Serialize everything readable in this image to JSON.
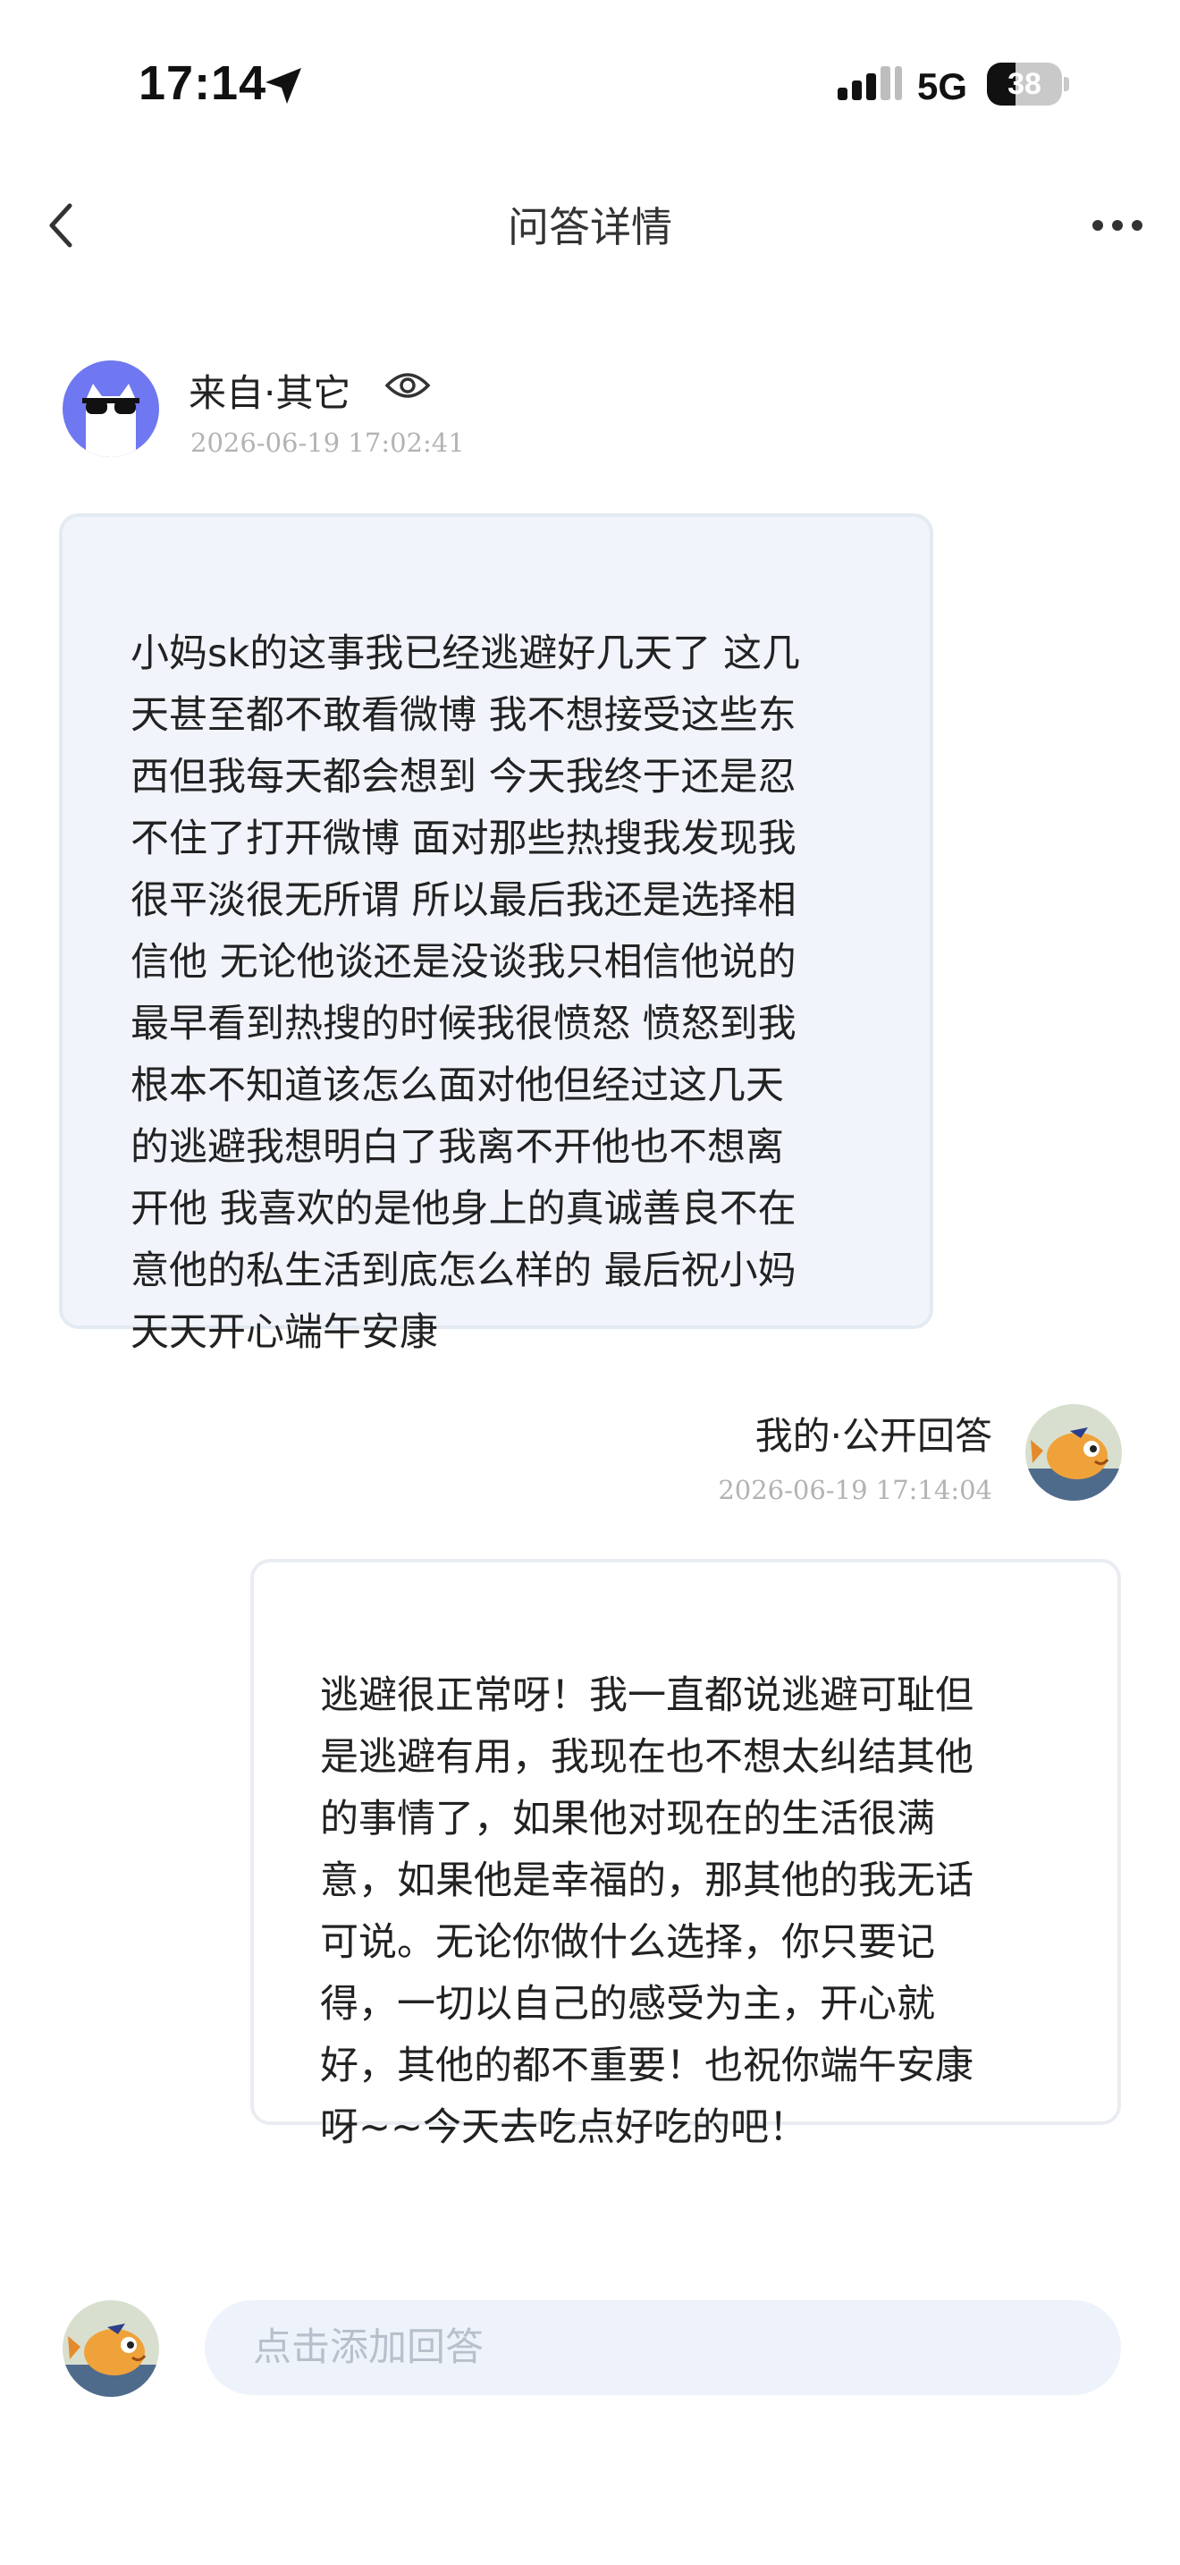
{
  "status_bar": {
    "time": "17:14",
    "network": "5G",
    "battery_level": "38",
    "battery_fraction": 0.38
  },
  "nav": {
    "title": "问答详情"
  },
  "question": {
    "from_label": "来自·其它",
    "time": "2026-06-19 17:02:41",
    "text": "小妈sk的这事我已经逃避好几天了 这几天甚至都不敢看微博 我不想接受这些东西但我每天都会想到 今天我终于还是忍不住了打开微博 面对那些热搜我发现我很平淡很无所谓 所以最后我还是选择相信他 无论他谈还是没谈我只相信他说的最早看到热搜的时候我很愤怒 愤怒到我根本不知道该怎么面对他但经过这几天的逃避我想明白了我离不开他也不想离开他 我喜欢的是他身上的真诚善良不在意他的私生活到底怎么样的 最后祝小妈天天开心端午安康",
    "lines": [
      "小妈sk的这事我已经逃避好几天了 这几",
      "天甚至都不敢看微博 我不想接受这些东",
      "西但我每天都会想到 今天我终于还是忍",
      "不住了打开微博 面对那些热搜我发现我",
      "很平淡很无所谓 所以最后我还是选择相",
      "信他 无论他谈还是没谈我只相信他说的",
      "最早看到热搜的时候我很愤怒 愤怒到我",
      "根本不知道该怎么面对他但经过这几天",
      "的逃避我想明白了我离不开他也不想离",
      "开他 我喜欢的是他身上的真诚善良不在",
      "意他的私生活到底怎么样的 最后祝小妈",
      "天天开心端午安康"
    ]
  },
  "answer": {
    "label": "我的·公开回答",
    "time": "2026-06-19 17:14:04",
    "lines": [
      "逃避很正常呀！我一直都说逃避可耻但",
      "是逃避有用，我现在也不想太纠结其他",
      "的事情了，如果他对现在的生活很满",
      "意，如果他是幸福的，那其他的我无话",
      "可说。无论你做什么选择，你只要记",
      "得，一切以自己的感受为主，开心就",
      "好，其他的都不重要！也祝你端午安康",
      "呀~~今天去吃点好吃的吧！"
    ]
  },
  "reply_bar": {
    "placeholder": "点击添加回答"
  },
  "icons": {
    "back": "chevron-left-icon",
    "more": "more-dots-icon",
    "eye": "eye-icon",
    "location": "location-arrow-icon",
    "signal": "signal-bars-icon"
  },
  "colors": {
    "question_bubble_bg": "#f1f5fb",
    "question_avatar_bg": "#6f78f0",
    "answer_avatar_bg": "#4f7fa3",
    "reply_input_bg": "#eef3fb",
    "timestamp": "#b3b3b3"
  }
}
